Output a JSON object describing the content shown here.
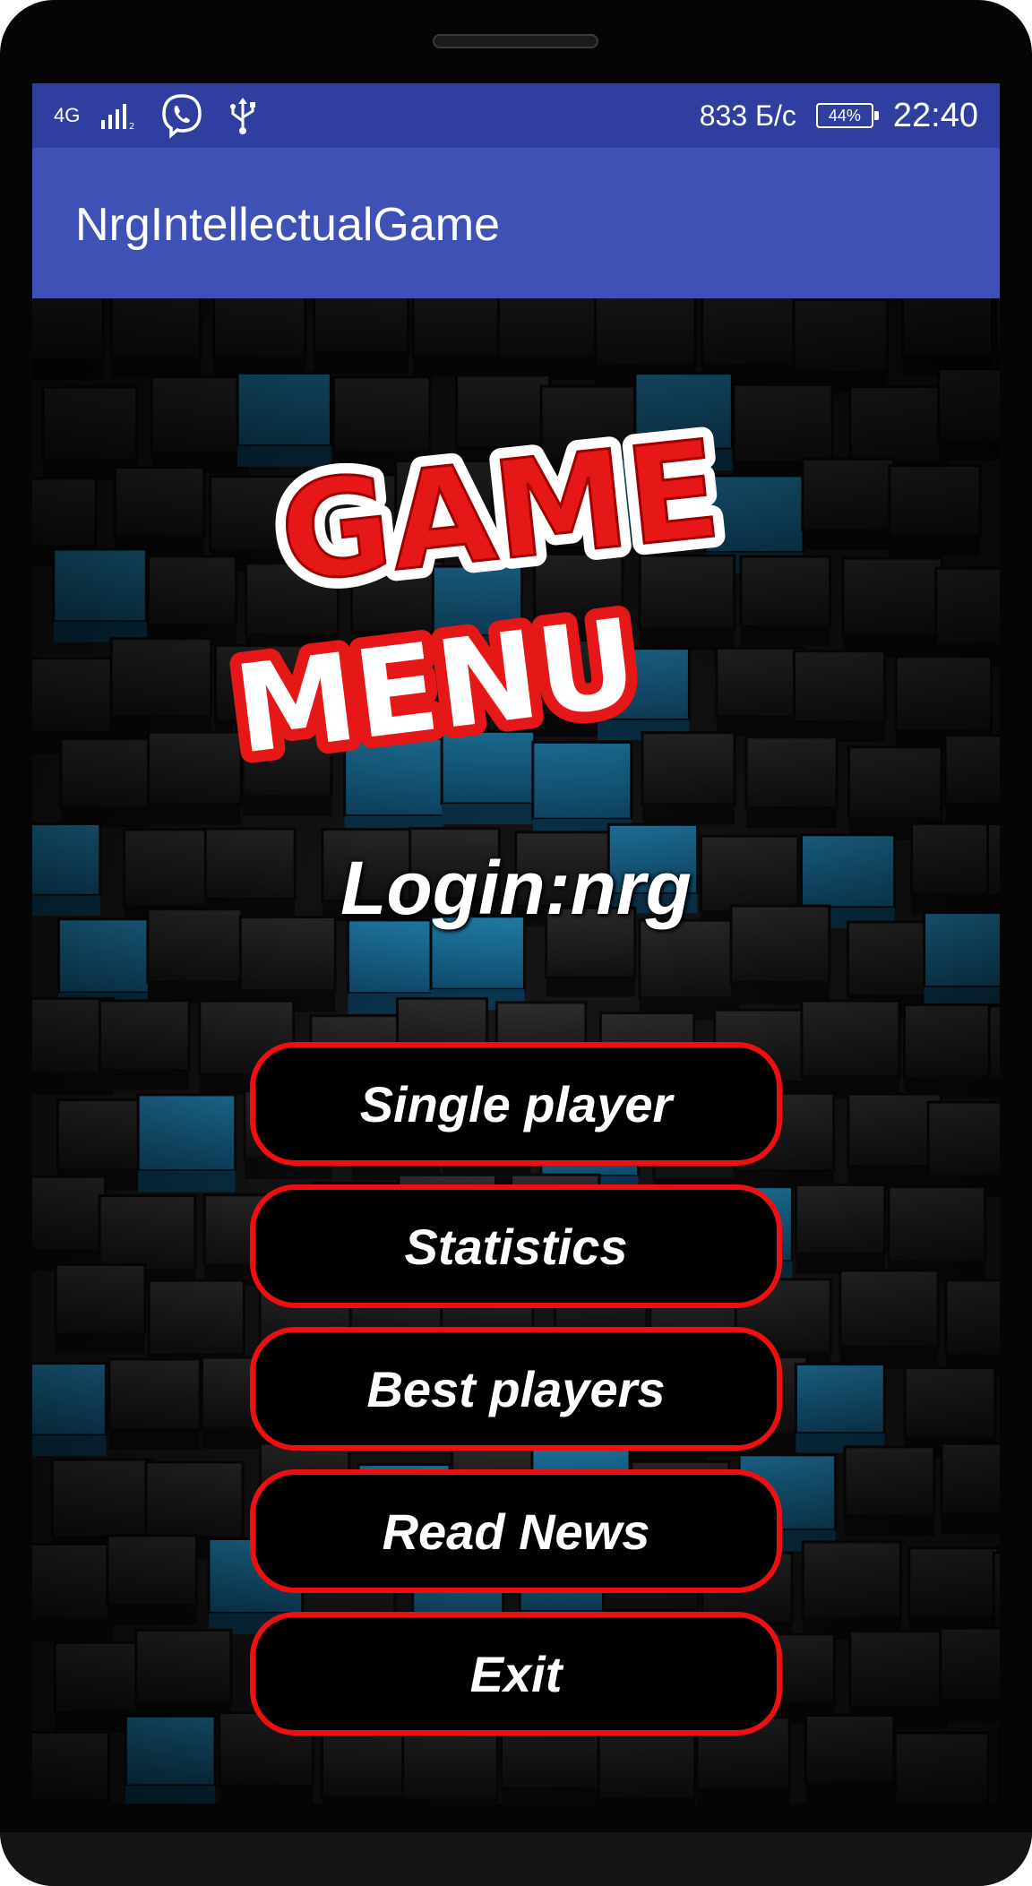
{
  "status_bar": {
    "network_type": "4G",
    "signal_icon": "signal-bars-icon",
    "viber_icon": "viber-icon",
    "usb_icon": "usb-icon",
    "net_speed": "833 Б/с",
    "battery": "44%",
    "time": "22:40",
    "color": "#303f9f"
  },
  "app_bar": {
    "title": "NrgIntellectualGame",
    "color": "#3f51b5"
  },
  "logo": {
    "line1": "GAME",
    "line2": "MENU"
  },
  "login": {
    "text": "Login:nrg"
  },
  "menu": {
    "items": [
      {
        "label": "Single player"
      },
      {
        "label": "Statistics"
      },
      {
        "label": "Best players"
      },
      {
        "label": "Read News"
      },
      {
        "label": "Exit"
      }
    ],
    "border_color": "#ee1010"
  },
  "background": {
    "accent_color": "#1e8ec7"
  }
}
